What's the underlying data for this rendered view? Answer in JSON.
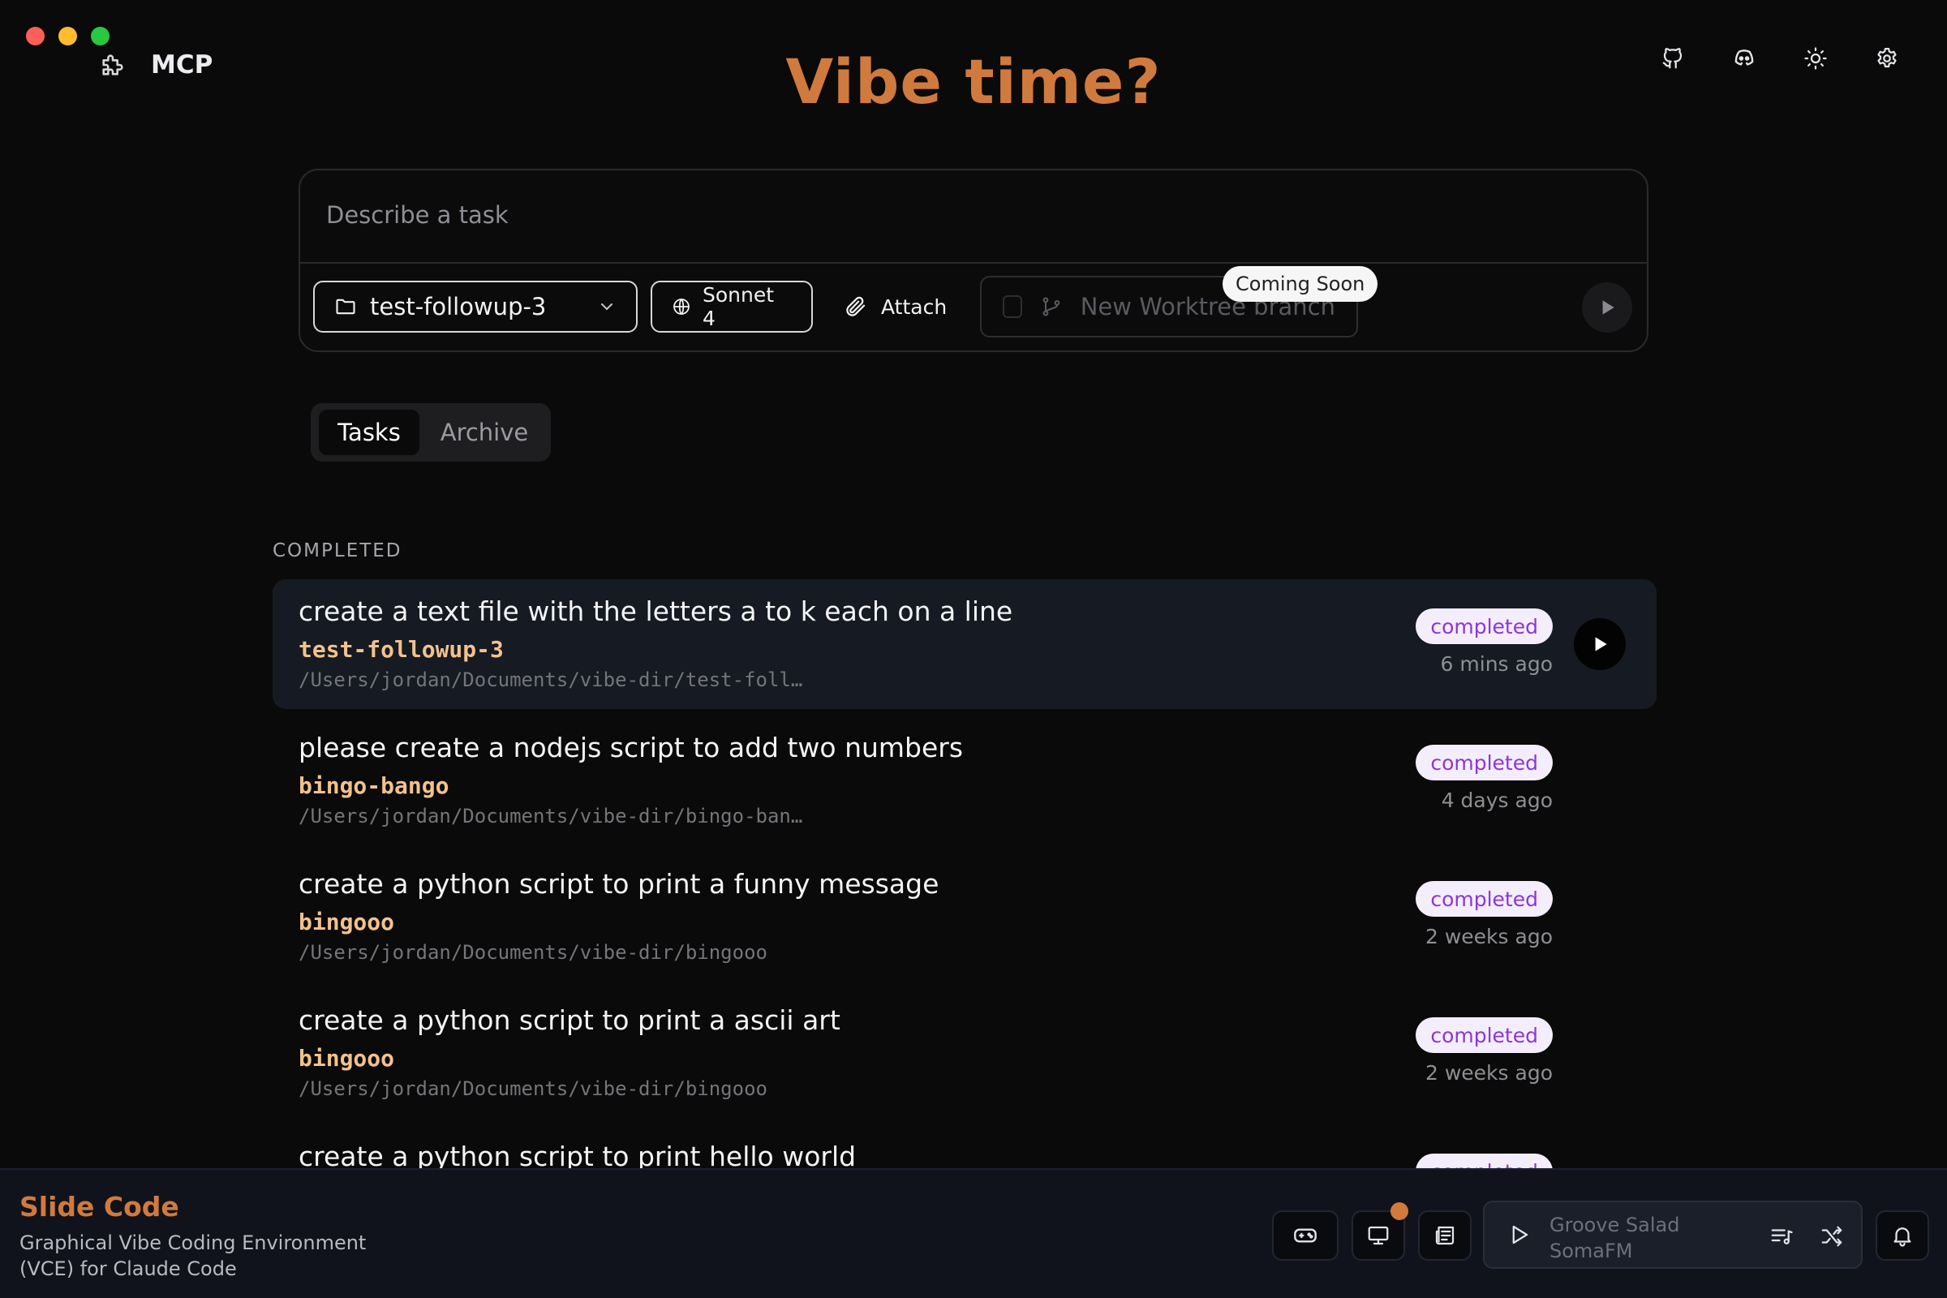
{
  "header": {
    "app_label": "MCP",
    "title": "Vibe time?",
    "icons": [
      "puzzle-icon",
      "github-icon",
      "discord-icon",
      "sun-icon",
      "gear-icon"
    ]
  },
  "composer": {
    "placeholder": "Describe a task",
    "repo_select": "test-followup-3",
    "model_button": "Sonnet 4",
    "attach_button": "Attach",
    "worktree_label": "New Worktree branch",
    "tooltip": "Coming Soon"
  },
  "tabs": [
    {
      "label": "Tasks",
      "active": true
    },
    {
      "label": "Archive",
      "active": false
    }
  ],
  "section": {
    "label": "COMPLETED"
  },
  "tasks": [
    {
      "title": "create a text file with the letters a to k each on a line",
      "branch": "test-followup-3",
      "path": "/Users/jordan/Documents/vibe-dir/test-foll…",
      "status": "completed",
      "time": "6 mins ago",
      "selected": true
    },
    {
      "title": "please create a nodejs script to add two numbers",
      "branch": "bingo-bango",
      "path": "/Users/jordan/Documents/vibe-dir/bingo-ban…",
      "status": "completed",
      "time": "4 days ago",
      "selected": false
    },
    {
      "title": "create a python script to print a funny message",
      "branch": "bingooo",
      "path": "/Users/jordan/Documents/vibe-dir/bingooo",
      "status": "completed",
      "time": "2 weeks ago",
      "selected": false
    },
    {
      "title": "create a python script to print a ascii art",
      "branch": "bingooo",
      "path": "/Users/jordan/Documents/vibe-dir/bingooo",
      "status": "completed",
      "time": "2 weeks ago",
      "selected": false
    },
    {
      "title": "create a python script to print hello world",
      "branch": "",
      "path": "",
      "status": "completed",
      "time": "",
      "selected": false
    }
  ],
  "footer": {
    "app_name": "Slide Code",
    "description": "Graphical Vibe Coding Environment (VCE) for Claude Code",
    "player": {
      "station": "Groove Salad",
      "stream": "SomaFM"
    }
  },
  "colors": {
    "accent": "#d17a3e",
    "branch": "#f3c18d",
    "badge_text": "#8b37d6",
    "badge_bg": "#f4eefc",
    "background": "#0a0a0a",
    "footer_bg": "#10131c"
  }
}
